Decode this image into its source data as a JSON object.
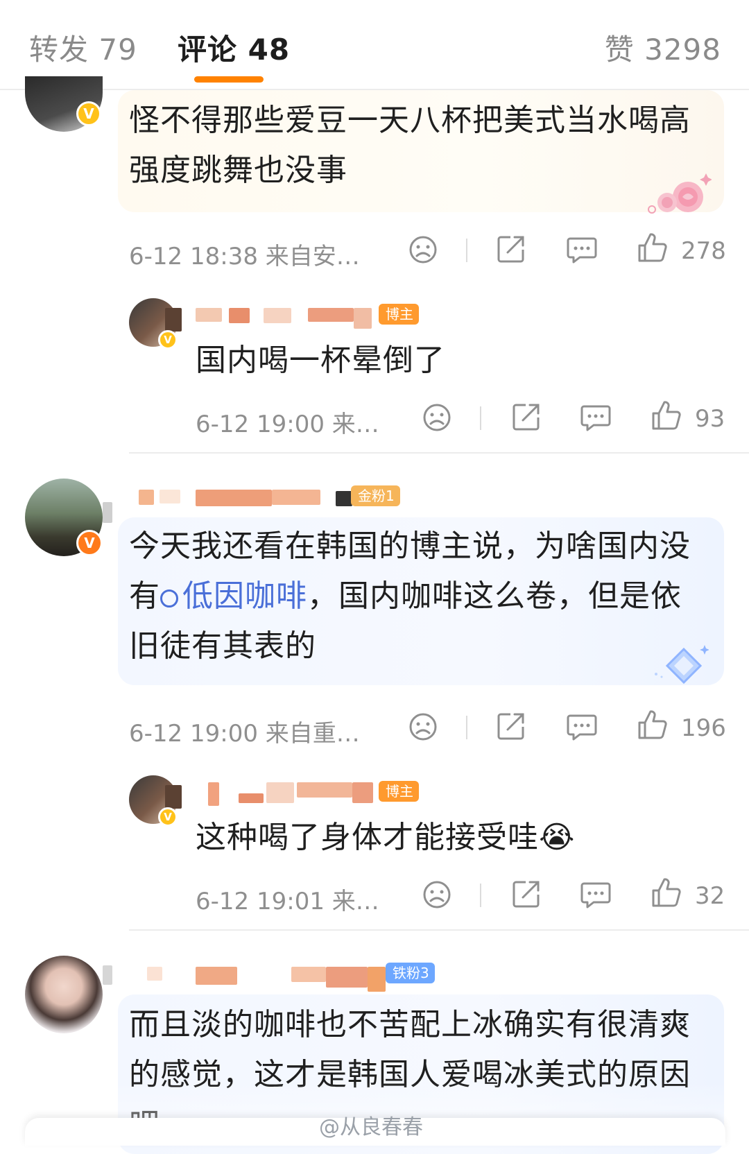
{
  "tabs": {
    "repost": "转发 79",
    "comments": "评论 48",
    "likes": "赞 3298"
  },
  "comments": [
    {
      "text": "怪不得那些爱豆一天八杯把美式当水喝高强度跳舞也没事",
      "meta": "6-12 18:38  来自安…",
      "like_count": "278",
      "bubble_style": "yellow-rose",
      "reply": {
        "tag": "博主",
        "text": "国内喝一杯晕倒了",
        "meta": "6-12 19:00  来…",
        "like_count": "93"
      }
    },
    {
      "tag": "金粉1",
      "text_before": "今天我还看在韩国的博主说，为啥国内没有",
      "link": "低因咖啡",
      "text_after": "，国内咖啡这么卷，但是依旧徒有其表的",
      "meta": "6-12 19:00  来自重…",
      "like_count": "196",
      "bubble_style": "blue-diamond",
      "reply": {
        "tag": "博主",
        "text": "这种喝了身体才能接受哇😭",
        "meta": "6-12 19:01  来…",
        "like_count": "32"
      }
    },
    {
      "tag": "铁粉3",
      "text": "而且淡的咖啡也不苦配上冰确实有很清爽的感觉，这才是韩国人爱喝冰美式的原因吧",
      "bubble_style": "blue"
    }
  ],
  "watermark": "@从良春春",
  "icons": [
    "sad-face-icon",
    "share-icon",
    "comment-icon",
    "thumbs-up-icon",
    "search-icon"
  ]
}
